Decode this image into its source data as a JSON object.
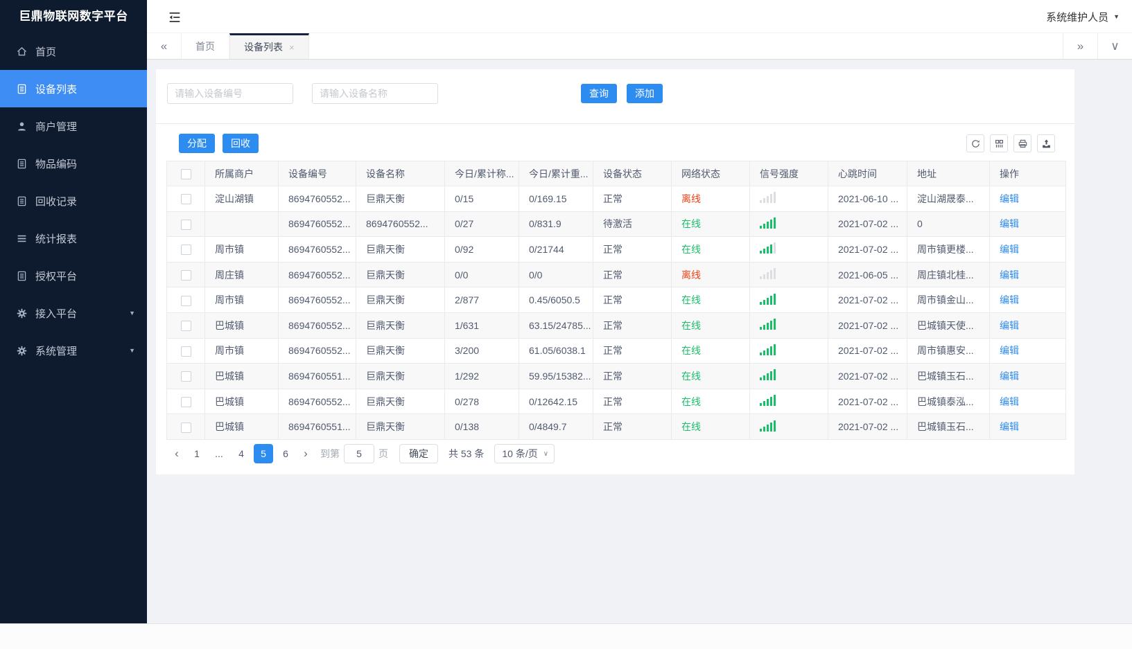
{
  "colors": {
    "accent": "#2d8cf0",
    "sidebar_active": "#3d8df5",
    "success_green": "#19be6b",
    "danger_red": "#ed4014",
    "sidebar_bg": "#0e1a2e"
  },
  "app": {
    "title": "巨鼎物联网数字平台",
    "user_menu": "系统维护人员"
  },
  "sidebar": {
    "items": [
      {
        "name": "home",
        "label": "首页",
        "icon": "home-icon",
        "active": false,
        "expandable": false
      },
      {
        "name": "device-list",
        "label": "设备列表",
        "icon": "device-list-icon",
        "active": true,
        "expandable": false
      },
      {
        "name": "merchant-manage",
        "label": "商户管理",
        "icon": "merchant-icon",
        "active": false,
        "expandable": false
      },
      {
        "name": "item-code",
        "label": "物品编码",
        "icon": "item-code-icon",
        "active": false,
        "expandable": false
      },
      {
        "name": "recycle-record",
        "label": "回收记录",
        "icon": "recycle-record-icon",
        "active": false,
        "expandable": false
      },
      {
        "name": "report",
        "label": "统计报表",
        "icon": "report-icon",
        "active": false,
        "expandable": false
      },
      {
        "name": "authorize",
        "label": "授权平台",
        "icon": "authorize-icon",
        "active": false,
        "expandable": false
      },
      {
        "name": "access-platform",
        "label": "接入平台",
        "icon": "access-gear-icon",
        "active": false,
        "expandable": true
      },
      {
        "name": "system-manage",
        "label": "系统管理",
        "icon": "system-gear-icon",
        "active": false,
        "expandable": true
      }
    ]
  },
  "tabbar": {
    "collapse_left": "«",
    "expand_right": "»",
    "dropdown": "∨",
    "tabs": [
      {
        "name": "home",
        "label": "首页",
        "active": false,
        "closable": false
      },
      {
        "name": "device-list",
        "label": "设备列表",
        "active": true,
        "closable": true,
        "close_glyph": "×"
      }
    ]
  },
  "search": {
    "device_no_placeholder": "请输入设备编号",
    "device_name_placeholder": "请输入设备名称",
    "query_label": "查询",
    "add_label": "添加"
  },
  "toolbar": {
    "assign_label": "分配",
    "recycle_label": "回收",
    "icons": [
      "refresh-icon",
      "columns-icon",
      "print-icon",
      "export-icon"
    ]
  },
  "table": {
    "columns": [
      "所属商户",
      "设备编号",
      "设备名称",
      "今日/累计称...",
      "今日/累计重...",
      "设备状态",
      "网络状态",
      "信号强度",
      "心跳时间",
      "地址",
      "操作"
    ],
    "action_label": "编辑",
    "rows": [
      {
        "merchant": "淀山湖镇",
        "device_no": "8694760552...",
        "device_name": "巨鼎天衡",
        "today_count": "0/15",
        "today_weight": "0/169.15",
        "device_status": "正常",
        "network_status": "离线",
        "online": false,
        "signal": 0,
        "heartbeat": "2021-06-10 ...",
        "address": "淀山湖晟泰..."
      },
      {
        "merchant": "",
        "device_no": "8694760552...",
        "device_name": "8694760552...",
        "today_count": "0/27",
        "today_weight": "0/831.9",
        "device_status": "待激活",
        "network_status": "在线",
        "online": true,
        "signal": 5,
        "heartbeat": "2021-07-02 ...",
        "address": "0"
      },
      {
        "merchant": "周市镇",
        "device_no": "8694760552...",
        "device_name": "巨鼎天衡",
        "today_count": "0/92",
        "today_weight": "0/21744",
        "device_status": "正常",
        "network_status": "在线",
        "online": true,
        "signal": 4,
        "heartbeat": "2021-07-02 ...",
        "address": "周市镇更楼..."
      },
      {
        "merchant": "周庄镇",
        "device_no": "8694760552...",
        "device_name": "巨鼎天衡",
        "today_count": "0/0",
        "today_weight": "0/0",
        "device_status": "正常",
        "network_status": "离线",
        "online": false,
        "signal": 0,
        "heartbeat": "2021-06-05 ...",
        "address": "周庄镇北桂..."
      },
      {
        "merchant": "周市镇",
        "device_no": "8694760552...",
        "device_name": "巨鼎天衡",
        "today_count": "2/877",
        "today_weight": "0.45/6050.5",
        "device_status": "正常",
        "network_status": "在线",
        "online": true,
        "signal": 5,
        "heartbeat": "2021-07-02 ...",
        "address": "周市镇金山..."
      },
      {
        "merchant": "巴城镇",
        "device_no": "8694760552...",
        "device_name": "巨鼎天衡",
        "today_count": "1/631",
        "today_weight": "63.15/24785...",
        "device_status": "正常",
        "network_status": "在线",
        "online": true,
        "signal": 5,
        "heartbeat": "2021-07-02 ...",
        "address": "巴城镇天使..."
      },
      {
        "merchant": "周市镇",
        "device_no": "8694760552...",
        "device_name": "巨鼎天衡",
        "today_count": "3/200",
        "today_weight": "61.05/6038.1",
        "device_status": "正常",
        "network_status": "在线",
        "online": true,
        "signal": 5,
        "heartbeat": "2021-07-02 ...",
        "address": "周市镇惠安..."
      },
      {
        "merchant": "巴城镇",
        "device_no": "8694760551...",
        "device_name": "巨鼎天衡",
        "today_count": "1/292",
        "today_weight": "59.95/15382...",
        "device_status": "正常",
        "network_status": "在线",
        "online": true,
        "signal": 5,
        "heartbeat": "2021-07-02 ...",
        "address": "巴城镇玉石..."
      },
      {
        "merchant": "巴城镇",
        "device_no": "8694760552...",
        "device_name": "巨鼎天衡",
        "today_count": "0/278",
        "today_weight": "0/12642.15",
        "device_status": "正常",
        "network_status": "在线",
        "online": true,
        "signal": 5,
        "heartbeat": "2021-07-02 ...",
        "address": "巴城镇泰泓..."
      },
      {
        "merchant": "巴城镇",
        "device_no": "8694760551...",
        "device_name": "巨鼎天衡",
        "today_count": "0/138",
        "today_weight": "0/4849.7",
        "device_status": "正常",
        "network_status": "在线",
        "online": true,
        "signal": 5,
        "heartbeat": "2021-07-02 ...",
        "address": "巴城镇玉石..."
      }
    ]
  },
  "pagination": {
    "prev": "‹",
    "next": "›",
    "pages": [
      "1",
      "...",
      "4",
      "5",
      "6"
    ],
    "active_page": "5",
    "jump_prefix": "到第",
    "jump_value": "5",
    "jump_suffix": "页",
    "confirm_label": "确定",
    "total_text": "共 53 条",
    "page_size": "10 条/页"
  }
}
